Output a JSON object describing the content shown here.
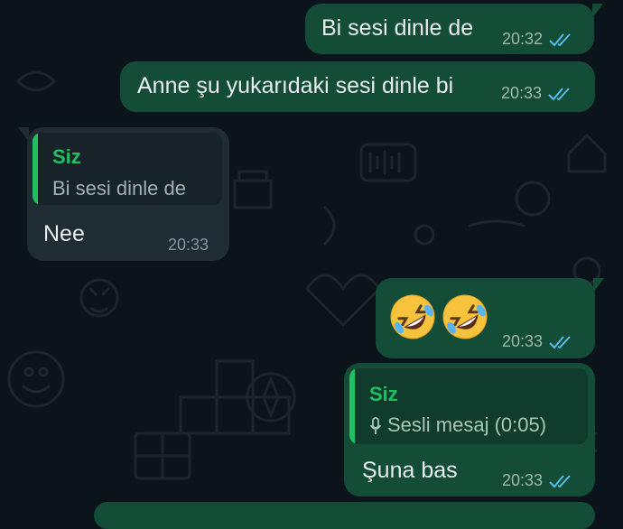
{
  "colors": {
    "background": "#0b141a",
    "outgoing_bubble": "#144d37",
    "incoming_bubble": "#1f2c34",
    "read_ticks": "#53bdeb",
    "quote_author": "#21c063"
  },
  "messages": [
    {
      "direction": "out",
      "text": "Bi sesi dinle de",
      "time": "20:32",
      "status": "read"
    },
    {
      "direction": "out",
      "text": "Anne şu yukarıdaki sesi dinle bi",
      "time": "20:33",
      "status": "read"
    },
    {
      "direction": "in",
      "quote": {
        "author": "Siz",
        "text": "Bi sesi dinle de"
      },
      "text": "Nee",
      "time": "20:33"
    },
    {
      "direction": "out",
      "emoji": [
        "rolling-on-floor-laughing",
        "rolling-on-floor-laughing"
      ],
      "time": "20:33",
      "status": "read"
    },
    {
      "direction": "out",
      "quote": {
        "author": "Siz",
        "text": "Sesli mesaj (0:05)",
        "icon": "mic-icon"
      },
      "text": "Şuna bas",
      "time": "20:33",
      "status": "read"
    }
  ]
}
